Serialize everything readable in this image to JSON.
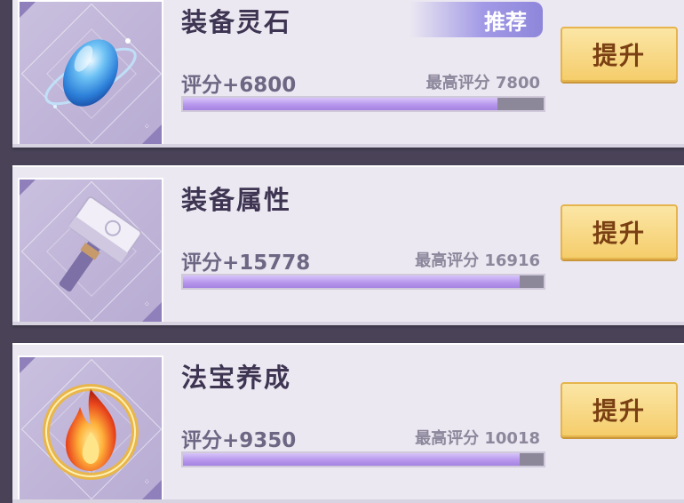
{
  "cards": [
    {
      "title": "装备灵石",
      "badge": "推荐",
      "score": "评分+6800",
      "max_label": "最高评分 7800",
      "progress": 0.872,
      "button": "提升",
      "icon": "blue-spirit-stone-icon"
    },
    {
      "title": "装备属性",
      "score": "评分+15778",
      "max_label": "最高评分 16916",
      "progress": 0.933,
      "button": "提升",
      "icon": "hammer-icon"
    },
    {
      "title": "法宝养成",
      "score": "评分+9350",
      "max_label": "最高评分 10018",
      "progress": 0.933,
      "button": "提升",
      "icon": "flame-treasure-icon"
    }
  ],
  "colors": {
    "progress_fill": "#b797ec",
    "button": "#f5cd6b",
    "badge": "#a29ae6"
  }
}
